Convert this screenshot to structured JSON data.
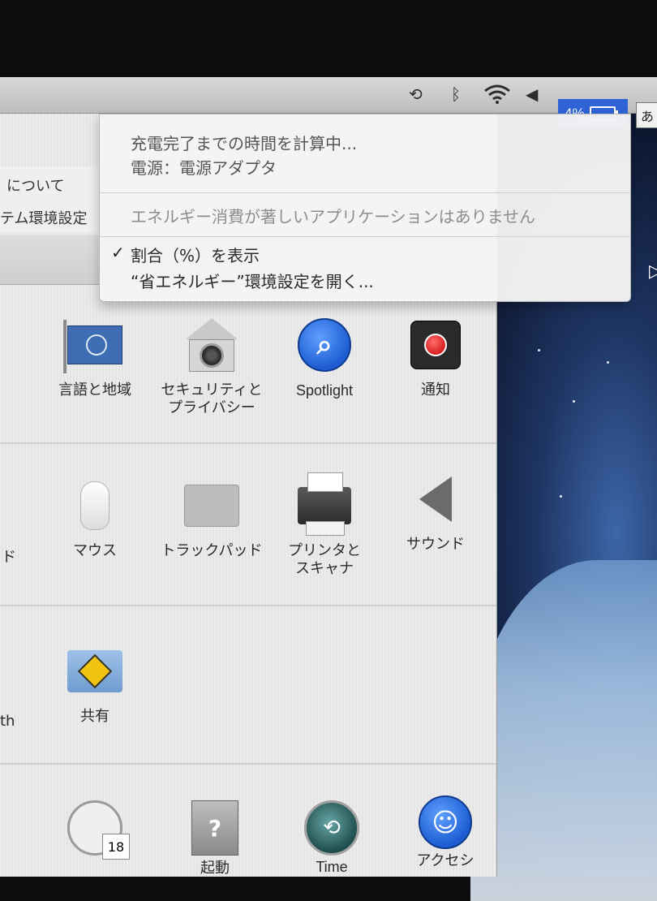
{
  "menubar": {
    "icons": [
      "time-machine-icon",
      "bluetooth-icon",
      "wifi-icon",
      "volume-icon"
    ],
    "battery_percent": "4%",
    "ime_label": "あ"
  },
  "battery_menu": {
    "status_line": "充電完了までの時間を計算中...",
    "source_line": "電源：電源アダプタ",
    "energy_info": "エネルギー消費が著しいアプリケーションはありません",
    "show_percent_label": "割合（%）を表示",
    "show_percent_checked": true,
    "check_mark": "✓",
    "open_prefs_label": "“省エネルギー”環境設定を開く..."
  },
  "app_menu": {
    "about_label": "について",
    "prefs_label": "テム環境設定"
  },
  "preferences": {
    "row1": [
      {
        "label": "言語と地域",
        "icon": "flag-icon"
      },
      {
        "label": "セキュリティと\nプライバシー",
        "icon": "security-house-icon"
      },
      {
        "label": "Spotlight",
        "icon": "spotlight-icon"
      },
      {
        "label": "通知",
        "icon": "notification-icon"
      }
    ],
    "row2": [
      {
        "label": "マウス",
        "icon": "mouse-icon"
      },
      {
        "label": "トラックパッド",
        "icon": "trackpad-icon"
      },
      {
        "label": "プリンタと\nスキャナ",
        "icon": "printer-icon"
      },
      {
        "label": "サウンド",
        "icon": "speaker-icon"
      }
    ],
    "row3": [
      {
        "label": "共有",
        "icon": "sharing-icon"
      }
    ],
    "row4": [
      {
        "label": "",
        "icon": "date-time-icon",
        "badge": "18"
      },
      {
        "label": "起動",
        "icon": "startup-disk-icon"
      },
      {
        "label": "Time",
        "icon": "time-machine-pref-icon"
      },
      {
        "label": "アクセシ",
        "icon": "accessibility-icon"
      }
    ],
    "edge_labels": [
      "ド",
      "th"
    ]
  }
}
